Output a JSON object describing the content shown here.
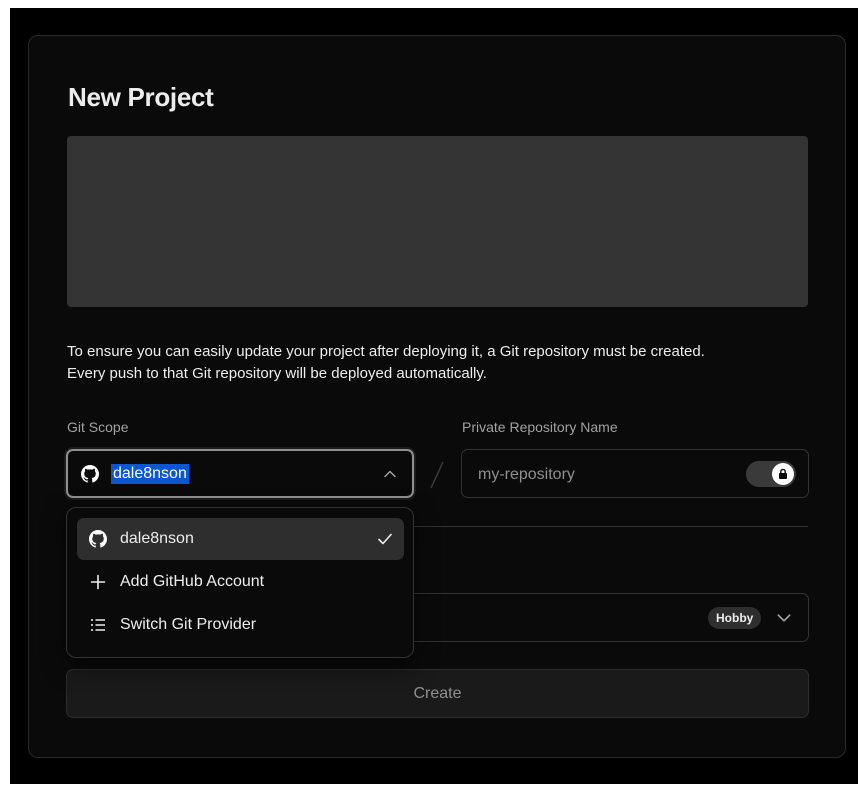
{
  "page": {
    "title": "New Project",
    "description_line1": "To ensure you can easily update your project after deploying it, a Git repository must be created.",
    "description_line2": "Every push to that Git repository will be deployed automatically."
  },
  "git_scope": {
    "label": "Git Scope",
    "selected": "dale8nson",
    "icon": "github-icon",
    "expanded": true
  },
  "repo": {
    "label": "Private Repository Name",
    "placeholder": "my-repository",
    "private": true,
    "toggle_icon": "lock-icon"
  },
  "dropdown": {
    "items": [
      {
        "label": "dale8nson",
        "icon": "github-icon",
        "selected": true
      },
      {
        "label": "Add GitHub Account",
        "icon": "plus-icon"
      },
      {
        "label": "Switch Git Provider",
        "icon": "list-icon"
      }
    ]
  },
  "team": {
    "plan_badge": "Hobby"
  },
  "actions": {
    "create_label": "Create"
  },
  "colors": {
    "background": "#0a0a0a",
    "border": "#333333",
    "preview": "#333333",
    "selection": "#0b57d0"
  }
}
